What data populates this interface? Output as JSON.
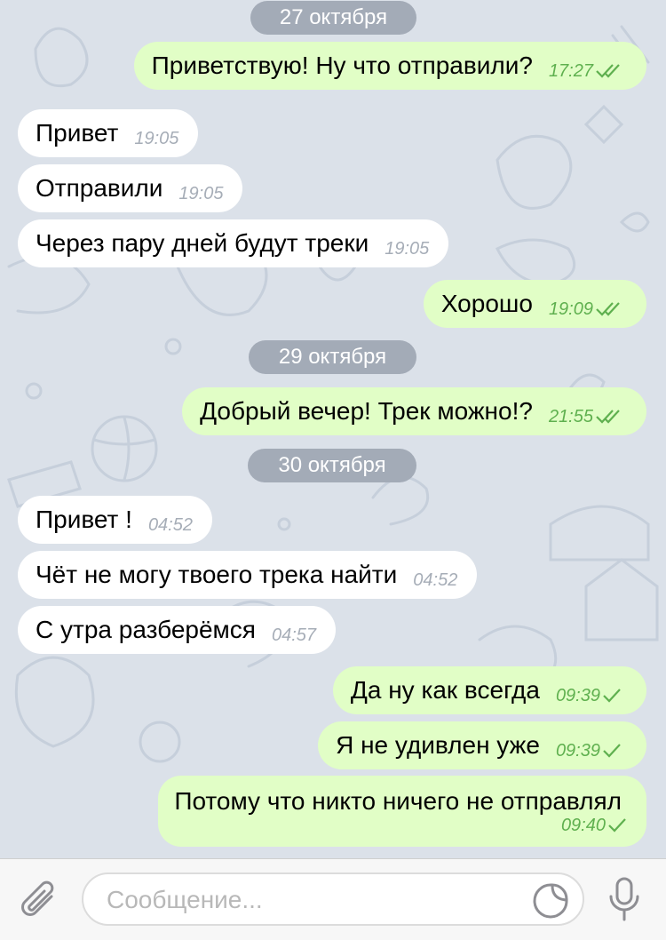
{
  "colors": {
    "background": "#dbe1e9",
    "incoming_bubble": "#ffffff",
    "outgoing_bubble": "#e1fec6",
    "date_pill": "#a3abb7",
    "check_green": "#5fb04f"
  },
  "dates": [
    "27 октября",
    "29 октября",
    "30 октября"
  ],
  "messages": [
    {
      "text": "Приветствую! Ну что отправили?",
      "time": "17:27",
      "status": "read"
    },
    {
      "text": "Привет",
      "time": "19:05"
    },
    {
      "text": "Отправили",
      "time": "19:05"
    },
    {
      "text": "Через пару дней будут треки",
      "time": "19:05"
    },
    {
      "text": "Хорошо",
      "time": "19:09",
      "status": "read"
    },
    {
      "text": "Добрый вечер! Трек можно!?",
      "time": "21:55",
      "status": "read"
    },
    {
      "text": "Привет !",
      "time": "04:52"
    },
    {
      "text": "Чёт не могу твоего трека найти",
      "time": "04:52"
    },
    {
      "text": "С утра разберёмся",
      "time": "04:57"
    },
    {
      "text": "Да ну как всегда",
      "time": "09:39",
      "status": "delivered"
    },
    {
      "text": "Я не удивлен уже",
      "time": "09:39",
      "status": "delivered"
    },
    {
      "text": "Потому что никто ничего не отправлял",
      "time": "09:40",
      "status": "delivered"
    }
  ],
  "input": {
    "placeholder": "Сообщение...",
    "value": ""
  },
  "icons": {
    "attach": "paperclip-icon",
    "sticker": "sticker-icon",
    "mic": "microphone-icon",
    "read": "double-check-icon",
    "delivered": "check-icon"
  }
}
